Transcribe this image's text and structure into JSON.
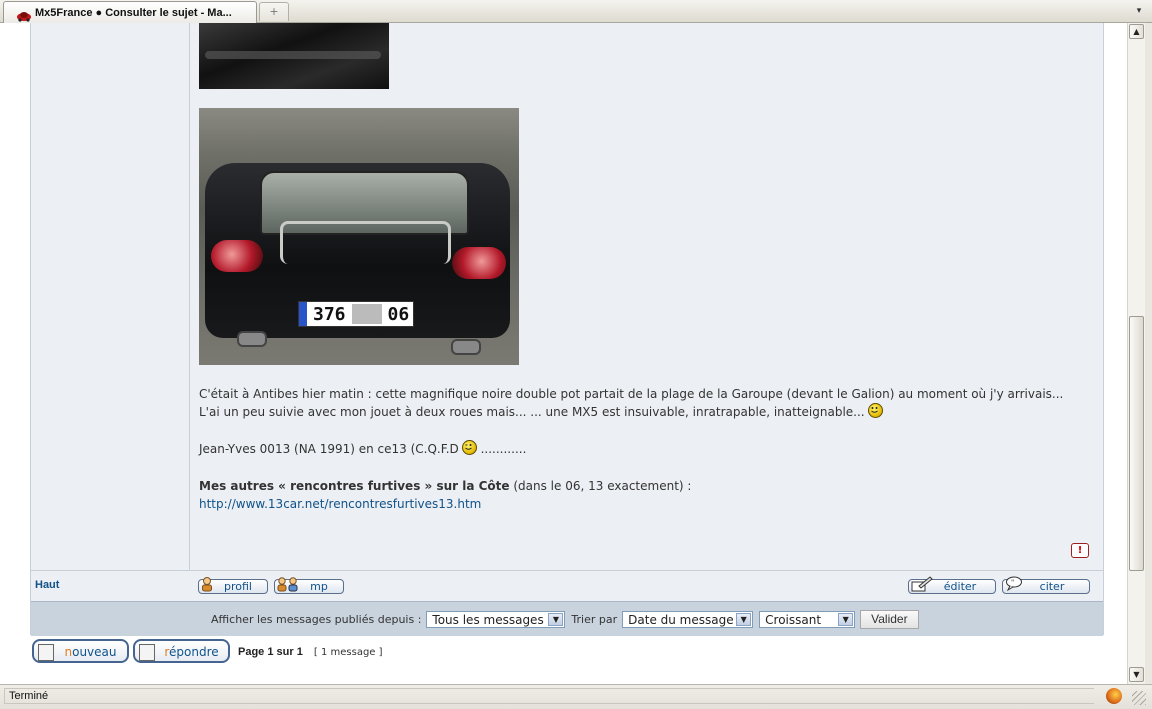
{
  "browser": {
    "tab_title": "Mx5France ● Consulter le sujet - Ma...",
    "new_tab_symbol": "+",
    "tab_list_symbol": "▾",
    "status_text": "Terminé"
  },
  "post": {
    "paragraph1_line1": "C'était à Antibes hier matin : cette magnifique noire double pot partait de la plage de la Garoupe (devant le Galion) au moment où j'y arrivais...",
    "paragraph1_line2": "L'ai un peu suivie avec mon jouet à deux roues mais... ... une MX5 est insuivable, inratrapable, inatteignable...",
    "signature_prefix": "Jean-Yves 0013 (NA 1991) en ce13 (C.Q.F.D",
    "signature_suffix": "............",
    "links_bold": "Mes autres « rencontres furtives » sur la Côte",
    "links_rest": " (dans le 06, 13 exactement) :",
    "link_url": "http://www.13car.net/rencontresfurtives13.htm",
    "photo_plate_left": "376",
    "photo_plate_right": "06",
    "report_symbol": "!"
  },
  "post_actions": {
    "haut": "Haut",
    "profil": "profil",
    "mp": "mp",
    "editer": "éditer",
    "citer": "citer"
  },
  "filter": {
    "label_display": "Afficher les messages publiés depuis :",
    "display_value": "Tous les messages",
    "label_sort": "Trier par",
    "sort_value": "Date du message",
    "order_value": "Croissant",
    "submit": "Valider"
  },
  "bottom": {
    "new_first": "n",
    "new_rest": "ouveau",
    "reply_first": "r",
    "reply_rest": "épondre",
    "page_text": "Page 1 sur 1",
    "message_count": "[ 1 message ]"
  },
  "colors": {
    "link": "#105289",
    "panel_bg": "#eceff3",
    "filter_bg": "#c9d3de",
    "accent_orange": "#e07b1a"
  },
  "icons": [
    "mx5-favicon",
    "profile-icon",
    "pm-icon",
    "edit-icon",
    "quote-icon",
    "report-icon",
    "smiley-icon",
    "wink-icon",
    "new-topic-icon",
    "reply-icon",
    "firefox-icon"
  ]
}
